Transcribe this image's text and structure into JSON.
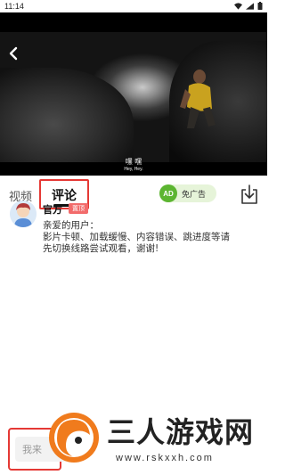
{
  "status_bar": {
    "time": "11:14"
  },
  "video": {
    "subtitle_main": "嘿 嘿",
    "subtitle_sub": "Hey, Hey."
  },
  "tabs": {
    "video": "视频",
    "comment": "评论"
  },
  "ad_toggle": {
    "badge": "AD",
    "label": "免广告"
  },
  "comment": {
    "author": "官方",
    "badge": "置顶",
    "lines": [
      "亲爱的用户：",
      "影片卡顿、加载缓慢、内容错误、跳进度等请",
      "先切换线路尝试观看，谢谢!"
    ]
  },
  "input": {
    "placeholder": "我来"
  },
  "watermark": {
    "text": "三人游戏网",
    "url": "www.rskxxh.com"
  },
  "colors": {
    "highlight": "#e53935",
    "ad_green": "#5cb531",
    "badge_red": "#f26b6b",
    "watermark_orange": "#f07b1d"
  }
}
